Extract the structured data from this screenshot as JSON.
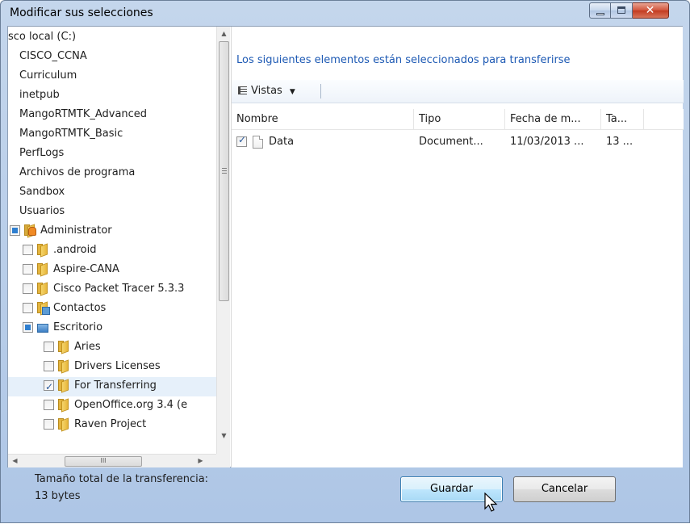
{
  "window": {
    "title": "Modificar sus selecciones",
    "minimize_icon": "minimize-icon",
    "maximize_icon": "maximize-icon",
    "close_icon": "close-icon",
    "close_glyph": "✕"
  },
  "tree": {
    "items": [
      {
        "label": "sco local (C:)",
        "checkbox": "none",
        "icon": "none"
      },
      {
        "label": "CISCO_CCNA",
        "checkbox": "none",
        "icon": "none"
      },
      {
        "label": "Curriculum",
        "checkbox": "none",
        "icon": "none"
      },
      {
        "label": "inetpub",
        "checkbox": "none",
        "icon": "none"
      },
      {
        "label": "MangoRTMTK_Advanced",
        "checkbox": "none",
        "icon": "none"
      },
      {
        "label": "MangoRTMTK_Basic",
        "checkbox": "none",
        "icon": "none"
      },
      {
        "label": "PerfLogs",
        "checkbox": "none",
        "icon": "none"
      },
      {
        "label": "Archivos de programa",
        "checkbox": "none",
        "icon": "none"
      },
      {
        "label": "Sandbox",
        "checkbox": "none",
        "icon": "none"
      },
      {
        "label": "Usuarios",
        "checkbox": "none",
        "icon": "none"
      },
      {
        "label": "Administrator",
        "checkbox": "partial",
        "icon": "user-folder-icon"
      },
      {
        "label": ".android",
        "checkbox": "unchecked",
        "icon": "folder-icon"
      },
      {
        "label": "Aspire-CANA",
        "checkbox": "unchecked",
        "icon": "folder-icon"
      },
      {
        "label": "Cisco Packet Tracer 5.3.3",
        "checkbox": "unchecked",
        "icon": "folder-icon"
      },
      {
        "label": "Contactos",
        "checkbox": "unchecked",
        "icon": "contacts-folder-icon"
      },
      {
        "label": "Escritorio",
        "checkbox": "partial",
        "icon": "desktop-folder-icon"
      },
      {
        "label": "Aries",
        "checkbox": "unchecked",
        "icon": "folder-icon"
      },
      {
        "label": "Drivers Licenses",
        "checkbox": "unchecked",
        "icon": "folder-icon"
      },
      {
        "label": "For Transferring",
        "checkbox": "checked",
        "icon": "folder-icon"
      },
      {
        "label": "OpenOffice.org 3.4 (e",
        "checkbox": "unchecked",
        "icon": "folder-icon"
      },
      {
        "label": "Raven Project",
        "checkbox": "unchecked",
        "icon": "folder-icon"
      }
    ]
  },
  "right_pane": {
    "heading": "Los siguientes elementos están seleccionados para transferirse",
    "views_label": "Vistas",
    "columns": [
      "Nombre",
      "Tipo",
      "Fecha de m...",
      "Ta..."
    ],
    "rows": [
      {
        "name": "Data",
        "type": "Document...",
        "date": "11/03/2013 ...",
        "size": "13 ...",
        "checked": true
      }
    ]
  },
  "footer": {
    "size_label": "Tamaño total de la transferencia:",
    "size_value": "13 bytes",
    "save_label": "Guardar",
    "cancel_label": "Cancelar"
  },
  "scroll": {
    "up_arrow": "▲",
    "down_arrow": "▼",
    "left_arrow": "◀",
    "right_arrow": "▶",
    "thumb_grip": "III"
  },
  "colors": {
    "heading_link": "#1e5ab4",
    "title_bar": "#b9cfeb",
    "close_button": "#c23b20"
  }
}
